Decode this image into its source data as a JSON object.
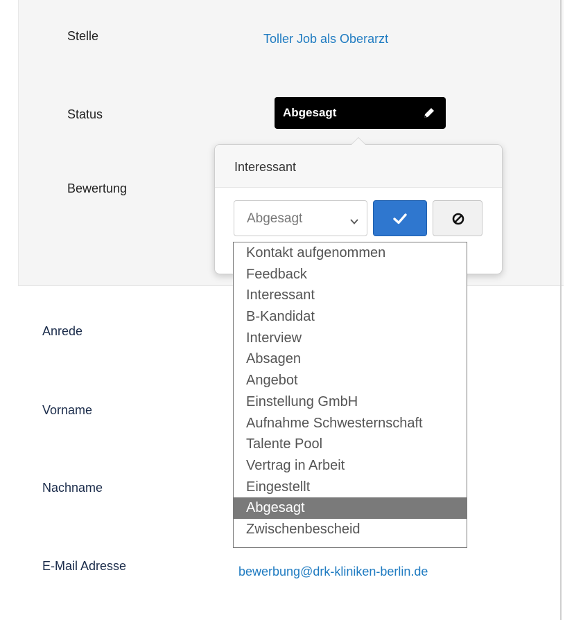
{
  "details": {
    "stelle_label": "Stelle",
    "stelle_value": "Toller Job als Oberarzt",
    "status_label": "Status",
    "status_value": "Abgesagt",
    "bewertung_label": "Bewertung"
  },
  "popover": {
    "title": "Interessant",
    "select_value": "Abgesagt",
    "confirm_icon": "check-icon",
    "cancel_icon": "ban-icon"
  },
  "dropdown": {
    "options": [
      "Kontakt aufgenommen",
      "Feedback",
      "Interessant",
      "B-Kandidat",
      "Interview",
      "Absagen",
      "Angebot",
      "Einstellung GmbH",
      "Aufnahme Schwesternschaft",
      "Talente Pool",
      "Vertrag in Arbeit",
      "Eingestellt",
      "Abgesagt",
      "Zwischenbescheid"
    ],
    "selected_index": 12
  },
  "form": {
    "anrede_label": "Anrede",
    "vorname_label": "Vorname",
    "nachname_label": "Nachname",
    "email_label": "E-Mail Adresse",
    "email_value": "bewerbung@drk-kliniken-berlin.de"
  },
  "colors": {
    "link": "#1f7bc1",
    "status_bg": "#000000",
    "primary_button": "#2f77cf",
    "selected_option": "#7a7a7a"
  }
}
